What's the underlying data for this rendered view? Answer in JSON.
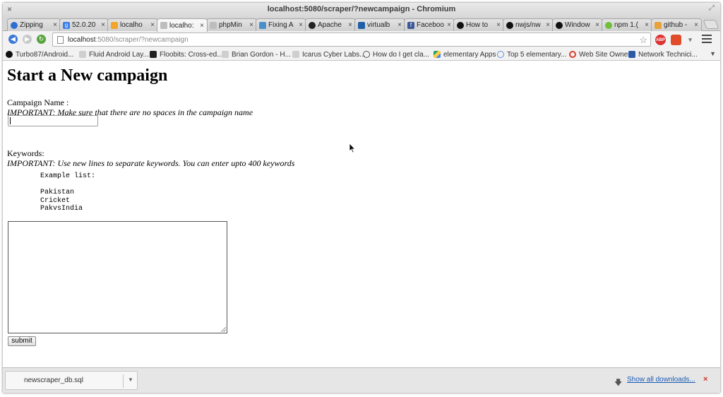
{
  "window": {
    "title": "localhost:5080/scraper/?newcampaign - Chromium",
    "close_glyph": "×",
    "maximize_glyph": "⤢"
  },
  "tabs": [
    {
      "label": "Zipping",
      "icon": "blue-circle-icon",
      "active": false
    },
    {
      "label": "52.0.20",
      "icon": "google-icon",
      "active": false
    },
    {
      "label": "localho",
      "icon": "phpmyadmin-icon",
      "active": false
    },
    {
      "label": "localho:",
      "icon": "page-icon",
      "active": true
    },
    {
      "label": "phpMin",
      "icon": "page-icon",
      "active": false
    },
    {
      "label": "Fixing A",
      "icon": "pf-icon",
      "active": false
    },
    {
      "label": "Apache",
      "icon": "linux-icon",
      "active": false
    },
    {
      "label": "virtualb",
      "icon": "virtualbox-icon",
      "active": false
    },
    {
      "label": "Faceboo",
      "icon": "facebook-icon",
      "active": false
    },
    {
      "label": "How to",
      "icon": "github-icon",
      "active": false
    },
    {
      "label": "nwjs/nw",
      "icon": "github-icon",
      "active": false
    },
    {
      "label": "Window",
      "icon": "github-icon",
      "active": false
    },
    {
      "label": "npm 1.(",
      "icon": "npm-icon",
      "active": false
    },
    {
      "label": "github -",
      "icon": "search-icon",
      "active": false
    }
  ],
  "tab_close_glyph": "×",
  "omnibox": {
    "host": "localhost",
    "path": ":5080/scraper/?newcampaign"
  },
  "extensions": {
    "adblock_label": "ABP"
  },
  "bookmarks": [
    {
      "label": "Turbo87/Android...",
      "icon": "github-icon"
    },
    {
      "label": "Fluid Android Lay...",
      "icon": "page-icon"
    },
    {
      "label": "Floobits: Cross-ed...",
      "icon": "floobits-icon"
    },
    {
      "label": "Brian Gordon - H...",
      "icon": "page-icon"
    },
    {
      "label": "Icarus Cyber Labs...",
      "icon": "page-icon"
    },
    {
      "label": "How do I get cla...",
      "icon": "ubuntu-icon"
    },
    {
      "label": "elementary Apps",
      "icon": "drive-icon"
    },
    {
      "label": "Top 5 elementary...",
      "icon": "globe-icon"
    },
    {
      "label": "Web Site Owner",
      "icon": "opera-icon"
    },
    {
      "label": "Network Technici...",
      "icon": "blue-book-icon"
    }
  ],
  "page": {
    "heading": "Start a New campaign",
    "campaign_label": "Campaign Name :",
    "campaign_note": "IMPORTANT: Make sure that there are no spaces in the campaign name",
    "campaign_value": "",
    "keywords_label": "Keywords:",
    "keywords_note": "IMPORTANT: Use new lines to separate keywords. You can enter upto 400 keywords",
    "example_list": "Example list:\n\nPakistan\nCricket\nPakvsIndia",
    "keywords_value": "",
    "submit_label": "submit"
  },
  "downloads": {
    "file_name": "newscraper_db.sql",
    "show_all_label": "Show all downloads...",
    "close_glyph": "×"
  }
}
